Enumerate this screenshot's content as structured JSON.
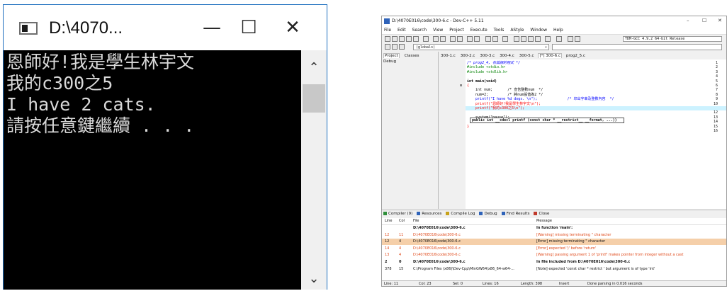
{
  "console": {
    "title": "D:\\4070...",
    "minimize": "—",
    "maximize": "☐",
    "close": "✕",
    "lines": [
      "恩師好!我是學生林宇文",
      "我的c300之5",
      "I have 2 cats.",
      "請按任意鍵繼續 . . ."
    ],
    "scroll_up": "⌃",
    "scroll_down": "⌄"
  },
  "ide": {
    "title": "D:\\4070E016\\code\\300-6.c - Dev-C++ 5.11",
    "window_controls": [
      "–",
      "☐",
      "✕"
    ],
    "menu": [
      "File",
      "Edit",
      "Search",
      "View",
      "Project",
      "Execute",
      "Tools",
      "AStyle",
      "Window",
      "Help"
    ],
    "compiler": "TDM-GCC 4.9.2 64-bit Release",
    "globals": "(globals)",
    "left_tabs": [
      "Project",
      "Classes",
      "Debug"
    ],
    "file_tabs": [
      "300-1.c",
      "300-2.c",
      "300-3.c",
      "300-4.c",
      "300-5.c",
      "[*] 300-6.c",
      "prog2_5.c"
    ],
    "active_file_tab": 5,
    "code": [
      {
        "n": "1",
        "text": "/* prog2_4, 有錯誤的程式 */",
        "color": "#0000ff",
        "italic": true
      },
      {
        "n": "2",
        "text": "#include <stdio.h>",
        "color": "#008000"
      },
      {
        "n": "3",
        "text": "#include <stdlib.h>",
        "color": "#008000"
      },
      {
        "n": "4",
        "text": ""
      },
      {
        "n": "5",
        "text": "int main(void)",
        "color": "#000000",
        "bold": true
      },
      {
        "n": "6",
        "text": "{",
        "color": "#ff0000",
        "fold": true
      },
      {
        "n": "7",
        "text": "    int num;       /* 宣告整數num  */",
        "color": "#000000"
      },
      {
        "n": "8",
        "text": "    num=2;         /* 將num設值為2 */",
        "color": "#000000"
      },
      {
        "n": "9",
        "text": "    printf(\"I have %d dogs. \\n\");              /* 印出字串及整數內容  */",
        "color": "#0000ff"
      },
      {
        "n": "10",
        "text": "    printf(\"恩師好!我是學生林宇文\\n\");",
        "color": "#ff0000"
      },
      {
        "n": "11",
        "text": "    printf(\"我的c300之5\\n\");",
        "color": "#ff0000",
        "highlight": true
      },
      {
        "n": "12",
        "text": "",
        "color": "#000000"
      },
      {
        "n": "13",
        "text": "    system(\"pause\");",
        "color": "#000000"
      },
      {
        "n": "14",
        "text": "    return 0;",
        "color": "#000000"
      },
      {
        "n": "15",
        "text": "}",
        "color": "#ff0000"
      },
      {
        "n": "16",
        "text": ""
      }
    ],
    "tooltip": "public int __cdecl printf (const char * __restrict__ __format, ...))",
    "bottom_tabs": [
      {
        "label": "Compiler (9)",
        "icon_color": "#2f8f3a"
      },
      {
        "label": "Resources",
        "icon_color": "#2f63b9"
      },
      {
        "label": "Compile Log",
        "icon_color": "#c7a21a"
      },
      {
        "label": "Debug",
        "icon_color": "#2f63b9"
      },
      {
        "label": "Find Results",
        "icon_color": "#2f63b9"
      },
      {
        "label": "Close",
        "icon_color": "#c0392b"
      }
    ],
    "msg_columns": [
      "Line",
      "Col",
      "File",
      "Message"
    ],
    "messages": [
      {
        "line": "",
        "col": "",
        "file": "D:\\4070E016\\code\\300-6.c",
        "msg": "In function 'main':",
        "kind": "bold"
      },
      {
        "line": "12",
        "col": "11",
        "file": "D:\\4070E016\\code\\300-6.c",
        "msg": "[Warning] missing terminating \" character",
        "kind": "err"
      },
      {
        "line": "12",
        "col": "4",
        "file": "D:\\4070E016\\code\\300-6.c",
        "msg": "[Error] missing terminating \" character",
        "kind": "selected"
      },
      {
        "line": "14",
        "col": "4",
        "file": "D:\\4070E016\\code\\300-6.c",
        "msg": "[Error] expected ')' before 'return'",
        "kind": "err"
      },
      {
        "line": "13",
        "col": "4",
        "file": "D:\\4070E016\\code\\300-6.c",
        "msg": "[Warning] passing argument 1 of 'printf' makes pointer from integer without a cast",
        "kind": "err"
      },
      {
        "line": "2",
        "col": "0",
        "file": "D:\\4070E016\\code\\300-6.c",
        "msg": "In file included from D:\\4070E016\\code\\300-6.c",
        "kind": "bold"
      },
      {
        "line": "378",
        "col": "15",
        "file": "C:\\Program Files (x86)\\Dev-Cpp\\MinGW64\\x86_64-w64-...",
        "msg": "[Note] expected 'const char *  restrict ' but argument is of type 'int'",
        "kind": "normal"
      },
      {
        "line": "",
        "col": "",
        "file": "",
        "msg": "",
        "kind": "normal"
      }
    ],
    "status": {
      "line": "Line:  11",
      "col": "Col:  23",
      "sel": "Sel:  0",
      "lines": "Lines:  16",
      "length": "Length:  398",
      "mode": "Insert",
      "msg": "Done parsing in 0.016 seconds"
    }
  }
}
